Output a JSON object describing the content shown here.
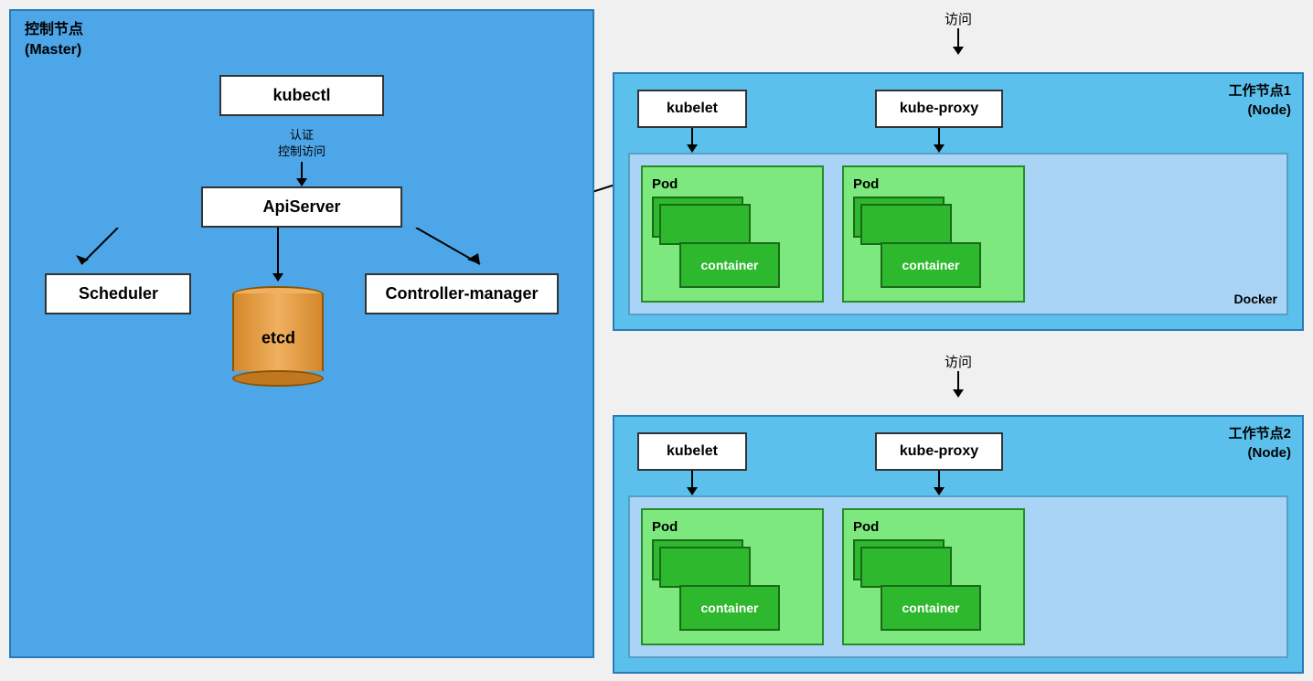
{
  "master": {
    "title_line1": "控制节点",
    "title_line2": "(Master)",
    "kubectl_label": "kubectl",
    "auth_line1": "认证",
    "auth_line2": "控制访问",
    "apiserver_label": "ApiServer",
    "scheduler_label": "Scheduler",
    "controller_label": "Controller-manager",
    "etcd_label": "etcd"
  },
  "node1": {
    "title_line1": "工作节点1",
    "title_line2": "(Node)",
    "access_label": "访问",
    "kubelet_label": "kubelet",
    "kube_proxy_label": "kube-proxy",
    "pod1_label": "Pod",
    "pod2_label": "Pod",
    "container1_label": "container",
    "container2_label": "container",
    "docker_label": "Docker"
  },
  "node2": {
    "title_line1": "工作节点2",
    "title_line2": "(Node)",
    "access_label": "访问",
    "kubelet_label": "kubelet",
    "kube_proxy_label": "kube-proxy",
    "pod1_label": "Pod",
    "pod2_label": "Pod",
    "container1_label": "container",
    "container2_label": "container"
  }
}
